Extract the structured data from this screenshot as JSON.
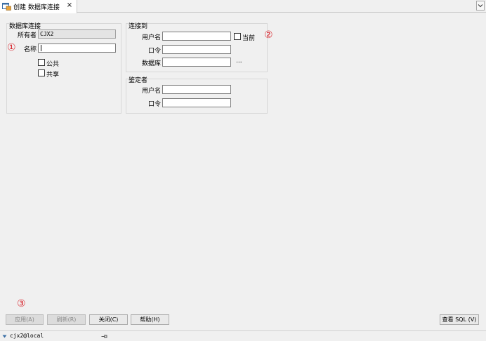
{
  "tab": {
    "label": "创建 数据库连接",
    "close": "×"
  },
  "left_group": {
    "title": "数据库连接",
    "owner_label": "所有者",
    "owner_value": "CJX2",
    "name_label": "名称",
    "name_value": "",
    "public_label": "公共",
    "shared_label": "共享"
  },
  "connect_group": {
    "title": "连接到",
    "username_label": "用户名",
    "username_value": "",
    "current_label": "当前",
    "password_label": "口令",
    "password_value": "",
    "database_label": "数据库",
    "database_value": "",
    "browse_label": "..."
  },
  "auth_group": {
    "title": "鉴定者",
    "username_label": "用户名",
    "username_value": "",
    "password_label": "口令",
    "password_value": ""
  },
  "markers": {
    "m1": "①",
    "m2": "②",
    "m3": "③"
  },
  "buttons": {
    "apply": "应用(A)",
    "refresh": "刷新(R)",
    "close": "关闭(C)",
    "help": "帮助(H)",
    "view_sql": "查看 SQL (V)"
  },
  "status": {
    "connection": "cjx2@local"
  },
  "colors": {
    "marker": "#d8262e"
  }
}
